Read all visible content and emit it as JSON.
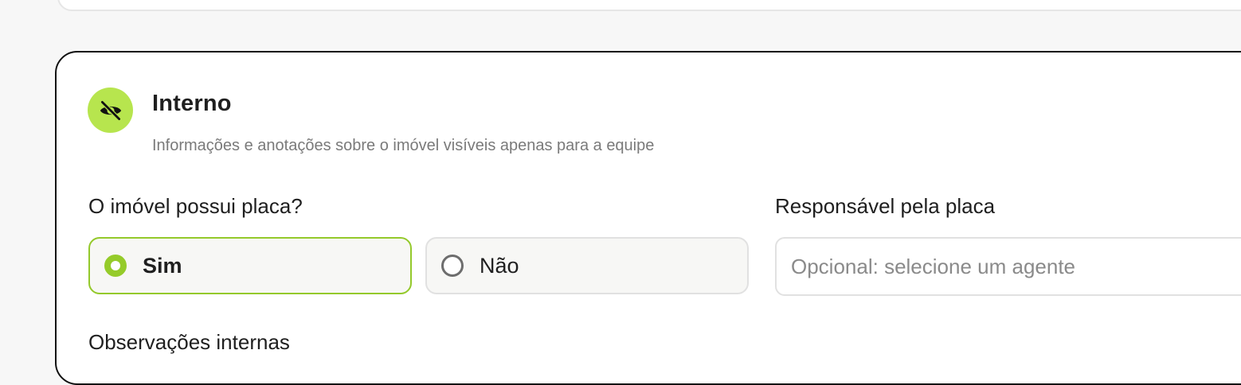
{
  "section": {
    "title": "Interno",
    "subtitle": "Informações e anotações sobre o imóvel visíveis apenas para a equipe",
    "icon": "eye-off-icon",
    "accent_color": "#b7e54e"
  },
  "placa_question": {
    "label": "O imóvel possui placa?",
    "options": [
      {
        "label": "Sim",
        "selected": true
      },
      {
        "label": "Não",
        "selected": false
      }
    ],
    "selected_color": "#95cb2a"
  },
  "responsavel": {
    "label": "Responsável pela placa",
    "placeholder": "Opcional: selecione um agente"
  },
  "observacoes": {
    "label": "Observações internas"
  }
}
